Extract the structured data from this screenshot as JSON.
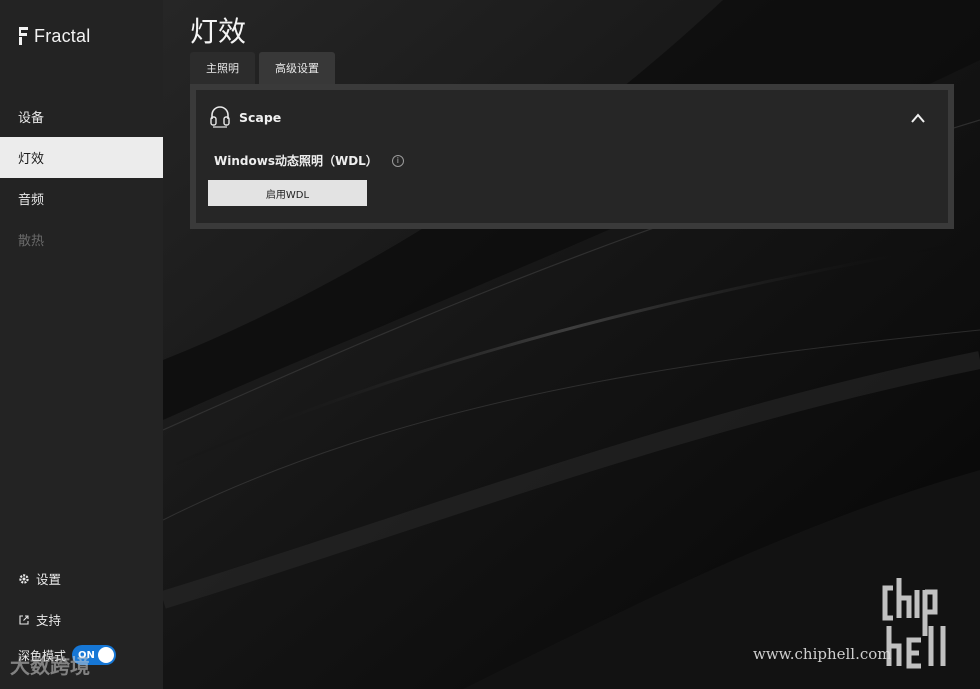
{
  "app": {
    "logo_text": "Fractal"
  },
  "sidebar": {
    "items": [
      {
        "label": "设备",
        "state": "normal"
      },
      {
        "label": "灯效",
        "state": "active"
      },
      {
        "label": "音频",
        "state": "normal"
      },
      {
        "label": "散热",
        "state": "disabled"
      }
    ],
    "bottom": {
      "settings_label": "设置",
      "support_label": "支持",
      "dark_mode_label": "深色模式",
      "dark_mode_toggle": "ON"
    }
  },
  "main": {
    "title": "灯效",
    "tabs": [
      {
        "label": "主照明"
      },
      {
        "label": "高级设置"
      }
    ],
    "device": {
      "name": "Scape",
      "wdl_label": "Windows动态照明（WDL）",
      "info_glyph": "i",
      "enable_button": "启用WDL"
    }
  },
  "watermarks": {
    "url": "www.chiphell.com",
    "left_text": "大数跨境"
  },
  "colors": {
    "sidebar_bg": "#232323",
    "active_nav_bg": "#ececec",
    "toggle_accent": "#1677d6",
    "panel_bg": "#3a3a3a",
    "card_bg": "#262626",
    "button_bg": "#e3e3e3"
  }
}
